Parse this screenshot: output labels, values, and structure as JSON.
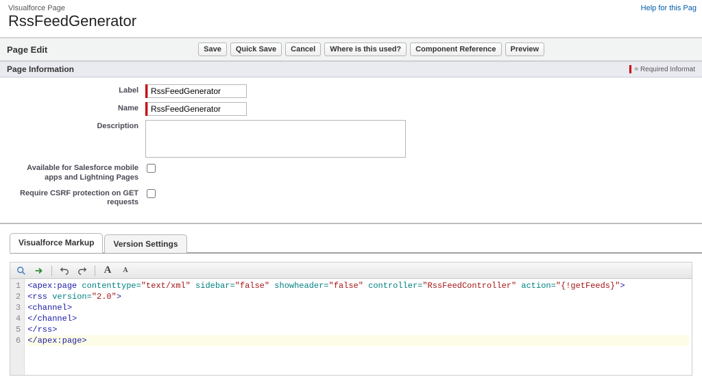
{
  "header": {
    "subtitle": "Visualforce Page",
    "title": "RssFeedGenerator",
    "help_link": "Help for this Pag"
  },
  "edit_bar": {
    "title": "Page Edit",
    "buttons": {
      "save": "Save",
      "quick_save": "Quick Save",
      "cancel": "Cancel",
      "where_used": "Where is this used?",
      "component_ref": "Component Reference",
      "preview": "Preview"
    }
  },
  "page_info": {
    "header": "Page Information",
    "required_note": "= Required Informat",
    "fields": {
      "label_label": "Label",
      "label_value": "RssFeedGenerator",
      "name_label": "Name",
      "name_value": "RssFeedGenerator",
      "description_label": "Description",
      "description_value": "",
      "mobile_label": "Available for Salesforce mobile apps and Lightning Pages",
      "csrf_label": "Require CSRF protection on GET requests"
    }
  },
  "tabs": {
    "markup": "Visualforce Markup",
    "versions": "Version Settings"
  },
  "editor": {
    "line_numbers": [
      "1",
      "2",
      "3",
      "4",
      "5",
      "6"
    ],
    "code": {
      "l1": {
        "tag_open": "<apex:page",
        "a1n": " contenttype=",
        "a1v": "\"text/xml\"",
        "a2n": " sidebar=",
        "a2v": "\"false\"",
        "a3n": " showheader=",
        "a3v": "\"false\"",
        "a4n": " controller=",
        "a4v": "\"RssFeedController\"",
        "a5n": " action=",
        "a5v": "\"{!getFeeds}\"",
        "tag_close": ">"
      },
      "l2": {
        "tag_open": "<rss",
        "a1n": " version=",
        "a1v": "\"2.0\"",
        "tag_close": ">"
      },
      "l3": "<channel>",
      "l4": "</channel>",
      "l5": "</rss>",
      "l6": "</apex:page>"
    }
  }
}
